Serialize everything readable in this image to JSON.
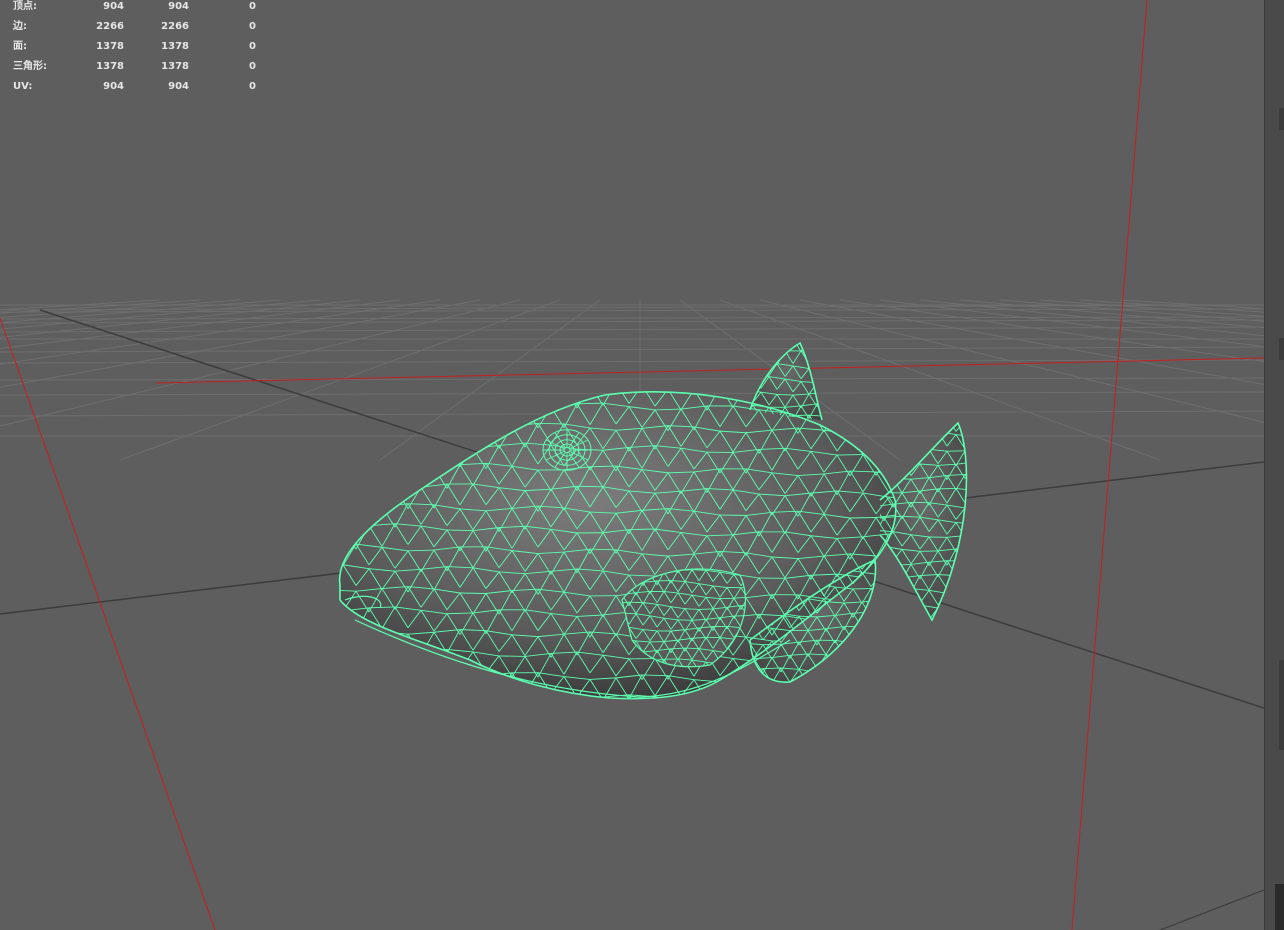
{
  "stats": {
    "rows": [
      {
        "label": "顶点:",
        "v1": "904",
        "v2": "904",
        "v3": "0"
      },
      {
        "label": "边:",
        "v1": "2266",
        "v2": "2266",
        "v3": "0"
      },
      {
        "label": "面:",
        "v1": "1378",
        "v2": "1378",
        "v3": "0"
      },
      {
        "label": "三角形:",
        "v1": "1378",
        "v2": "1378",
        "v3": "0"
      },
      {
        "label": "UV:",
        "v1": "904",
        "v2": "904",
        "v3": "0"
      }
    ]
  },
  "viewport": {
    "background_color": "#5e5e5e",
    "grid_color": "#6e6e6e",
    "grid_axis_color": "#3c3c3c",
    "camera_line_color": "#c81e1e",
    "wireframe_color": "#5dffb0"
  }
}
